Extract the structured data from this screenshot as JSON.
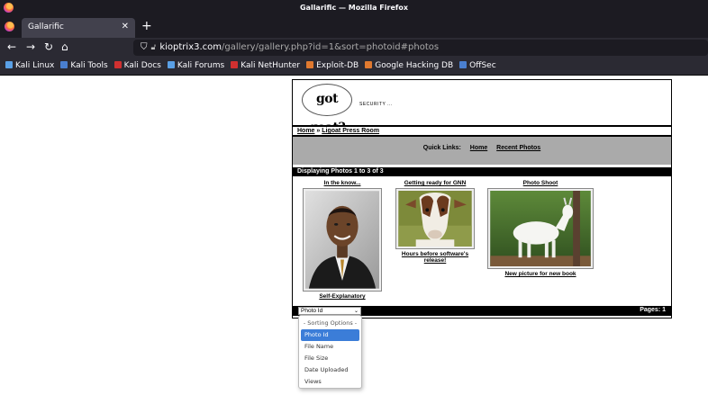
{
  "browser": {
    "window_title": "Gallarific — Mozilla Firefox",
    "tab_title": "Gallarific",
    "url_host": "kioptrix3.com",
    "url_path": "/gallery/gallery.php?id=1&sort=photoid#photos",
    "bookmarks": [
      {
        "label": "Kali Linux",
        "icon": "kali-dragon-icon",
        "color": "#5aa0e6"
      },
      {
        "label": "Kali Tools",
        "icon": "kali-tools-icon",
        "color": "#4a7fd0"
      },
      {
        "label": "Kali Docs",
        "icon": "kali-docs-icon",
        "color": "#d03030"
      },
      {
        "label": "Kali Forums",
        "icon": "kali-forums-icon",
        "color": "#5aa0e6"
      },
      {
        "label": "Kali NetHunter",
        "icon": "nethunter-icon",
        "color": "#d03030"
      },
      {
        "label": "Exploit-DB",
        "icon": "exploit-db-icon",
        "color": "#e0792f"
      },
      {
        "label": "Google Hacking DB",
        "icon": "ghdb-icon",
        "color": "#e0792f"
      },
      {
        "label": "OffSec",
        "icon": "offsec-icon",
        "color": "#4a7fd0"
      }
    ]
  },
  "gallery": {
    "logo_text": "got goat?",
    "tagline": "SECURITY ...",
    "breadcrumb_home": "Home",
    "breadcrumb_sep": " » ",
    "breadcrumb_current": "Ligoat Press Room",
    "quick_links_label": "Quick Links:",
    "quick_links": [
      "Home",
      "Recent Photos"
    ],
    "display_text": "Displaying Photos 1 to 3 of 3",
    "photos": [
      {
        "title": "In the know...",
        "caption": "Self-Explanatory"
      },
      {
        "title": "Getting ready for GNN",
        "caption": "Hours before software's release!"
      },
      {
        "title": "Photo Shoot",
        "caption": "New picture for new book"
      }
    ],
    "sort_selected": "Photo Id",
    "pages_text": "Pages: 1",
    "sort_options": [
      "- Sorting Options -",
      "Photo Id",
      "File Name",
      "File Size",
      "Date Uploaded",
      "Views"
    ]
  }
}
